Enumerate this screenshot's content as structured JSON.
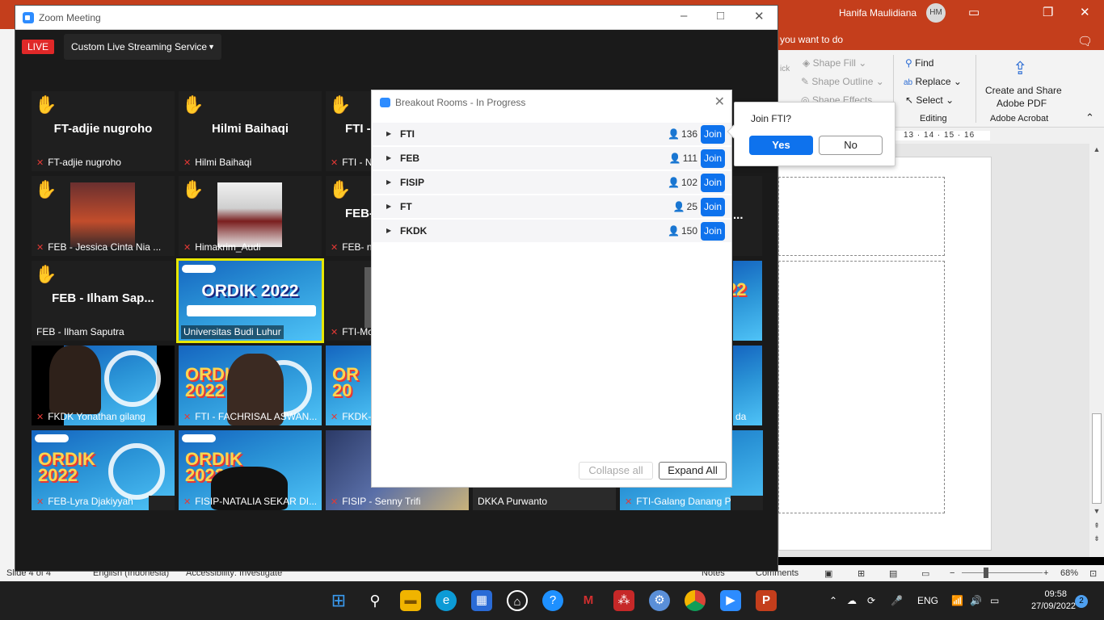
{
  "ppt": {
    "user_name": "Hanifa Maulidiana",
    "user_initials": "HM",
    "tell_me": "you want to do",
    "ribbon": {
      "shape_fill": "Shape Fill",
      "shape_outline": "Shape Outline",
      "shape_effects": "Shape Effects",
      "quick_partial": "ick",
      "find": "Find",
      "replace": "Replace",
      "select": "Select",
      "editing_group": "Editing",
      "create_share": "Create and Share",
      "adobe_pdf": "Adobe PDF",
      "acrobat_group": "Adobe Acrobat"
    },
    "ruler_text": "13 · 14 · 15 · 16",
    "status": {
      "slide": "Slide 4 of 4",
      "language": "English (Indonesia)",
      "accessibility": "Accessibility: Investigate",
      "notes": "Notes",
      "comments": "Comments",
      "zoom": "68%"
    }
  },
  "zoom": {
    "window_title": "Zoom Meeting",
    "live_label": "LIVE",
    "streaming_label": "Custom Live Streaming Service",
    "tiles": [
      {
        "big": "FT-adjie nugroho",
        "caption": "FT-adjie nugroho"
      },
      {
        "big": "Hilmi Baihaqi",
        "caption": "Hilmi Baihaqi"
      },
      {
        "big": "FTI - N",
        "caption": "FTI - N"
      },
      {
        "caption": "FEB - Jessica Cinta Nia ..."
      },
      {
        "caption": "Himakrim_Audi"
      },
      {
        "big": "FEB-",
        "caption": "FEB- n"
      },
      {
        "big": "FEB - Ilham Sap...",
        "caption": "FEB - Ilham Saputra"
      },
      {
        "caption": "Universitas Budi Luhur",
        "banner": "ORDIK 2022"
      },
      {
        "caption": "FTI-Mo"
      },
      {
        "caption": "FKDK Yonathan gilang"
      },
      {
        "caption": "FTI - FACHRISAL ASWAN..."
      },
      {
        "caption": "FKDK-"
      },
      {
        "caption": "FEB-Lyra Djakiyyah",
        "banner": "ORDIK 2022"
      },
      {
        "caption": "FISIP-NATALIA SEKAR DI...",
        "banner": "ORDIK 2022"
      },
      {
        "caption": "FISIP - Senny Trifi"
      },
      {
        "caption": "DKKA Purwanto"
      },
      {
        "caption": "FTI-Galang Danang P"
      },
      {
        "caption": "da"
      }
    ],
    "overflow_tile_text": "..."
  },
  "breakout": {
    "title": "Breakout Rooms - In Progress",
    "rooms": [
      {
        "name": "FTI",
        "count": "136",
        "join": "Join"
      },
      {
        "name": "FEB",
        "count": "111",
        "join": "Join"
      },
      {
        "name": "FISIP",
        "count": "102",
        "join": "Join"
      },
      {
        "name": "FT",
        "count": "25",
        "join": "Join"
      },
      {
        "name": "FKDK",
        "count": "150",
        "join": "Join"
      }
    ],
    "collapse_all": "Collapse all",
    "expand_all": "Expand All"
  },
  "join_popup": {
    "question": "Join FTI?",
    "yes": "Yes",
    "no": "No"
  },
  "taskbar": {
    "language": "ENG",
    "time": "09:58",
    "date": "27/09/2022",
    "notifications": "2"
  },
  "colors": {
    "ppt_accent": "#c43e1c",
    "zoom_blue": "#0e72ed",
    "live_red": "#e02828",
    "hand_yellow": "#ffc400"
  }
}
